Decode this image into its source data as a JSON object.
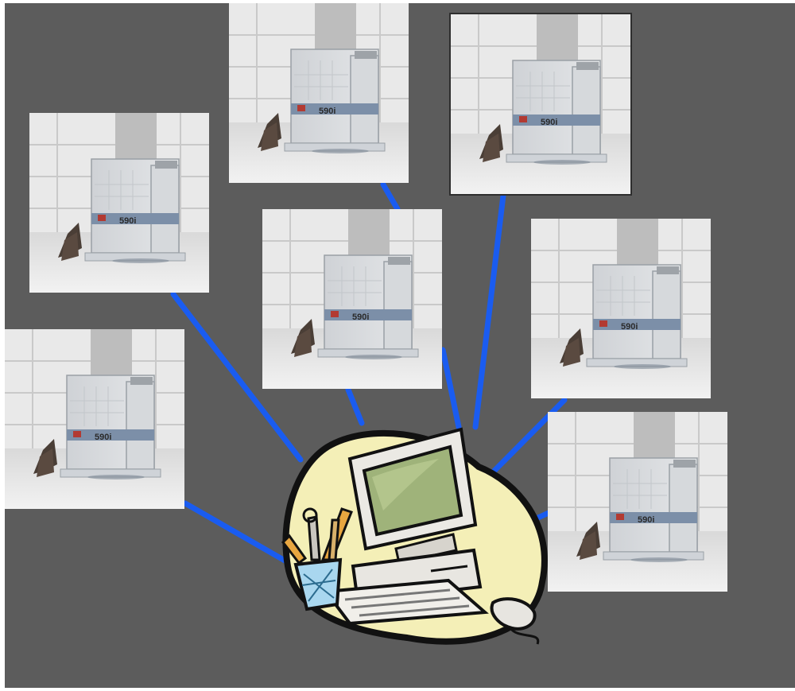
{
  "diagram": {
    "printer_model_label": "590i",
    "connector_color": "#1a5cf0",
    "background_color": "#5c5c5c",
    "printers": [
      {
        "id": "printer-top-center"
      },
      {
        "id": "printer-top-right"
      },
      {
        "id": "printer-upper-left"
      },
      {
        "id": "printer-center"
      },
      {
        "id": "printer-right"
      },
      {
        "id": "printer-left"
      },
      {
        "id": "printer-bottom-right"
      }
    ],
    "hub": {
      "icon": "computer-icon"
    }
  }
}
